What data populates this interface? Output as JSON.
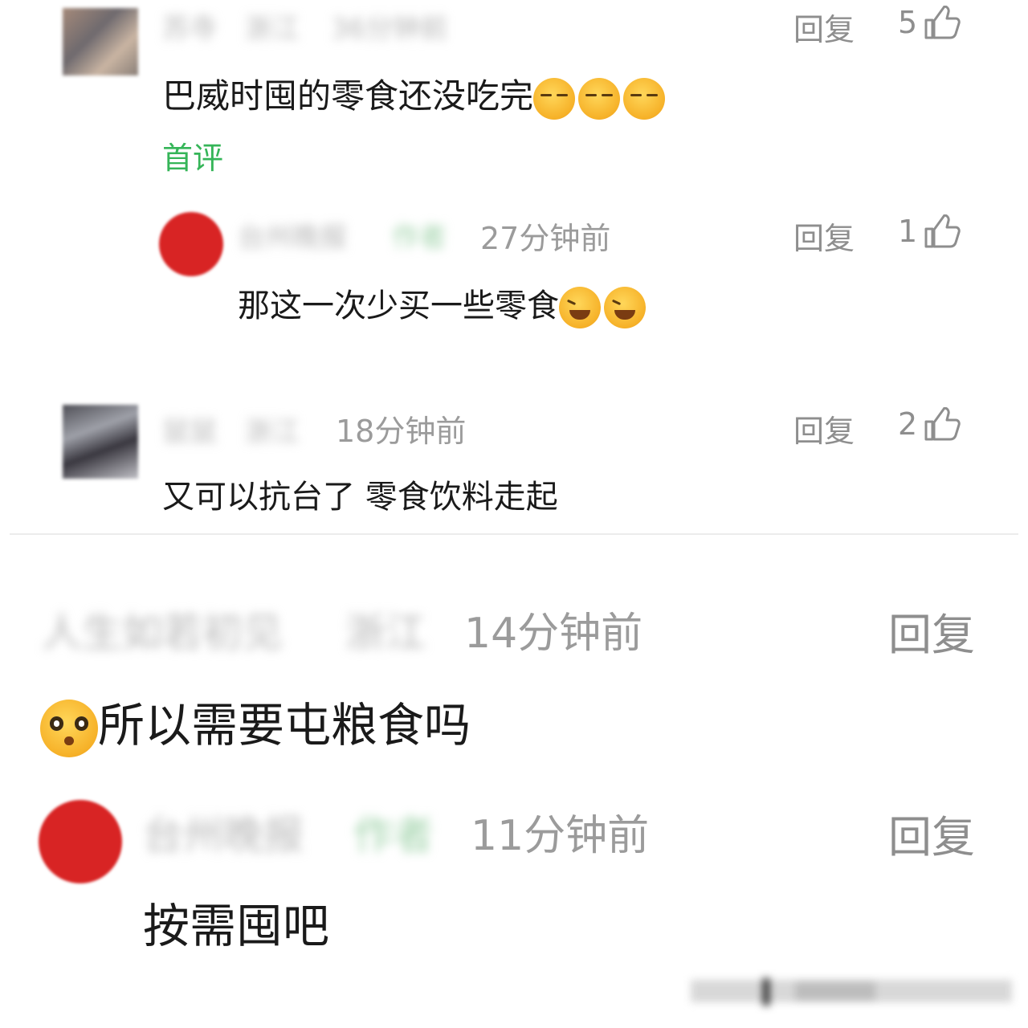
{
  "thread": {
    "c1": {
      "username": "苏寺",
      "location": "浙江",
      "time": "36分钟前",
      "text": "巴威时囤的零食还没吃完",
      "tag": "首评",
      "reply_label": "回复",
      "likes": "5",
      "emojis": [
        "relieved-face",
        "relieved-face",
        "relieved-face"
      ]
    },
    "c1_reply": {
      "username": "台州晚报",
      "badge": "作者",
      "time": "27分钟前",
      "text": "那这一次少买一些零食",
      "reply_label": "回复",
      "likes": "1",
      "emojis": [
        "tears-of-joy-face",
        "tears-of-joy-face"
      ]
    },
    "c2": {
      "username": "鼠鼠",
      "location": "浙江",
      "time": "18分钟前",
      "text": "又可以抗台了 零食饮料走起",
      "reply_label": "回复",
      "likes": "2"
    }
  },
  "thread2": {
    "c3": {
      "username": "人生如若初见",
      "location": "浙江",
      "time": "14分钟前",
      "text": "所以需要屯粮食吗",
      "reply_label": "回复",
      "emojis": [
        "pleading-face"
      ]
    },
    "c3_reply": {
      "username": "台州晚报",
      "badge": "作者",
      "time": "11分钟前",
      "text": "按需囤吧",
      "reply_label": "回复"
    }
  },
  "colors": {
    "tag_green": "#35b558",
    "meta_gray": "#9b9b9b",
    "avatar_red": "#d82424"
  }
}
